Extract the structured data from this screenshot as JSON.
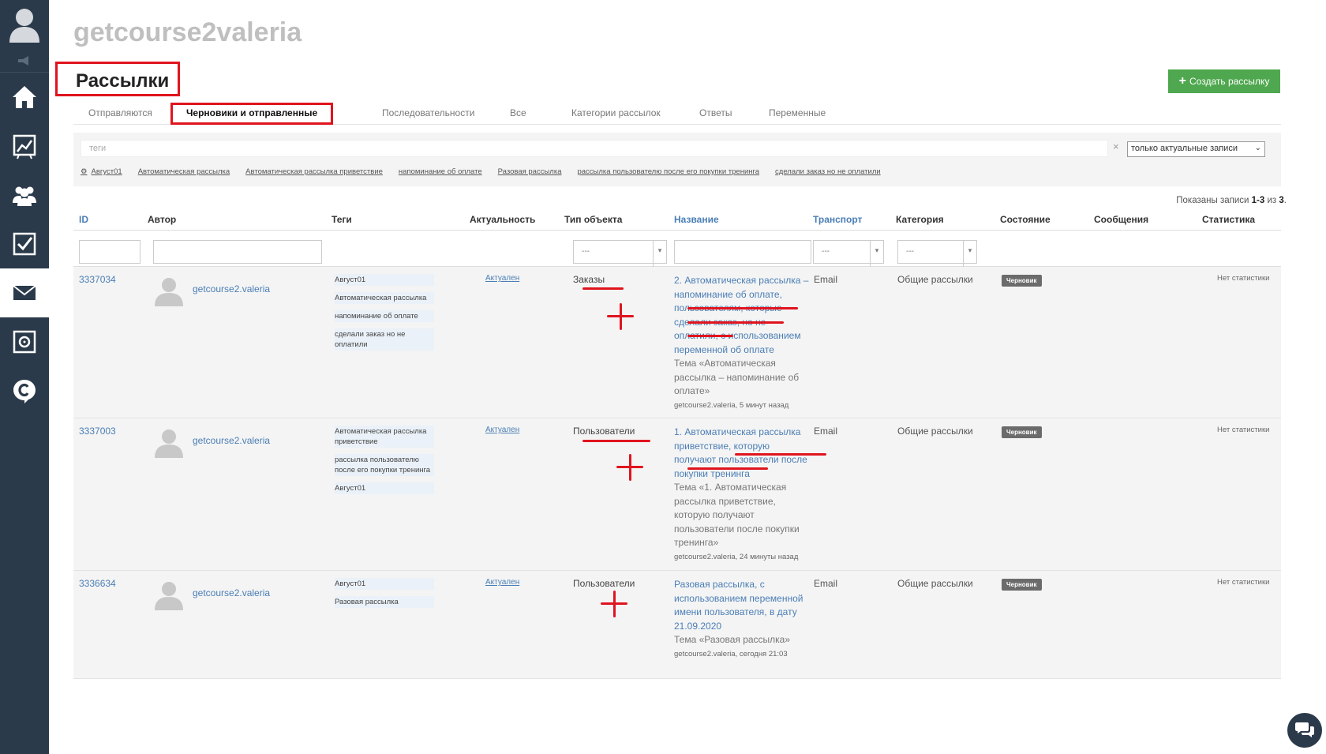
{
  "school_name": "getcourse2valeria",
  "page_title": "Рассылки",
  "create_button": "Создать рассылку",
  "tabs": [
    {
      "label": "Отправляются",
      "active": false
    },
    {
      "label": "Черновики и отправленные",
      "active": true
    },
    {
      "label": "Последовательности",
      "active": false
    },
    {
      "label": "Все",
      "active": false
    },
    {
      "label": "Категории рассылок",
      "active": false
    },
    {
      "label": "Ответы",
      "active": false
    },
    {
      "label": "Переменные",
      "active": false
    }
  ],
  "filters": {
    "tags_placeholder": "теги",
    "clear_symbol": "×",
    "actual_select": "только актуальные записи",
    "tag_chips": [
      "Август01",
      "Автоматическая рассылка",
      "Автоматическая рассылка приветствие",
      "напоминание об оплате",
      "Разовая рассылка",
      "рассылка пользователю после его покупки тренинга",
      "сделали заказ но не оплатили"
    ]
  },
  "records_info": {
    "prefix": "Показаны записи",
    "range": "1-3",
    "middle": "из",
    "total": "3",
    "suffix": "."
  },
  "columns": {
    "id": "ID",
    "author": "Автор",
    "tags": "Теги",
    "actual": "Актуальность",
    "type": "Тип объекта",
    "name": "Название",
    "transport": "Транспорт",
    "category": "Категория",
    "state": "Состояние",
    "messages": "Сообщения",
    "stats": "Статистика"
  },
  "column_filters": {
    "type": "---",
    "transport": "---",
    "category": "---"
  },
  "rows": [
    {
      "id": "3337034",
      "author": "getcourse2.valeria",
      "tags": [
        "Август01",
        "Автоматическая рассылка",
        "напоминание об оплате",
        "сделали заказ но не оплатили"
      ],
      "actual": "Актуален",
      "type": "Заказы",
      "name": "2. Автоматическая рассылка – напоминание об оплате, пользователям, которые сделали заказ, но не оплатили, с использованием переменной об оплате",
      "subject": "Тема «Автоматическая рассылка – напоминание об оплате»",
      "meta": "getcourse2.valeria, 5 минут назад",
      "transport": "Email",
      "category": "Общие рассылки",
      "state": "Черновик",
      "stats": "Нет статистики"
    },
    {
      "id": "3337003",
      "author": "getcourse2.valeria",
      "tags": [
        "Автоматическая рассылка приветствие",
        "рассылка пользователю после его покупки тренинга",
        "Август01"
      ],
      "actual": "Актуален",
      "type": "Пользователи",
      "name": "1. Автоматическая рассылка приветствие, которую получают пользователи после покупки тренинга",
      "subject": "Тема «1. Автоматическая рассылка приветствие, которую получают пользователи после покупки тренинга»",
      "meta": "getcourse2.valeria, 24 минуты назад",
      "transport": "Email",
      "category": "Общие рассылки",
      "state": "Черновик",
      "stats": "Нет статистики"
    },
    {
      "id": "3336634",
      "author": "getcourse2.valeria",
      "tags": [
        "Август01",
        "Разовая рассылка"
      ],
      "actual": "Актуален",
      "type": "Пользователи",
      "name": "Разовая рассылка, с использованием переменной имени пользователя, в дату 21.09.2020",
      "subject": "Тема «Разовая рассылка»",
      "meta": "getcourse2.valeria, сегодня 21:03",
      "transport": "Email",
      "category": "Общие рассылки",
      "state": "Черновик",
      "stats": "Нет статистики"
    }
  ]
}
